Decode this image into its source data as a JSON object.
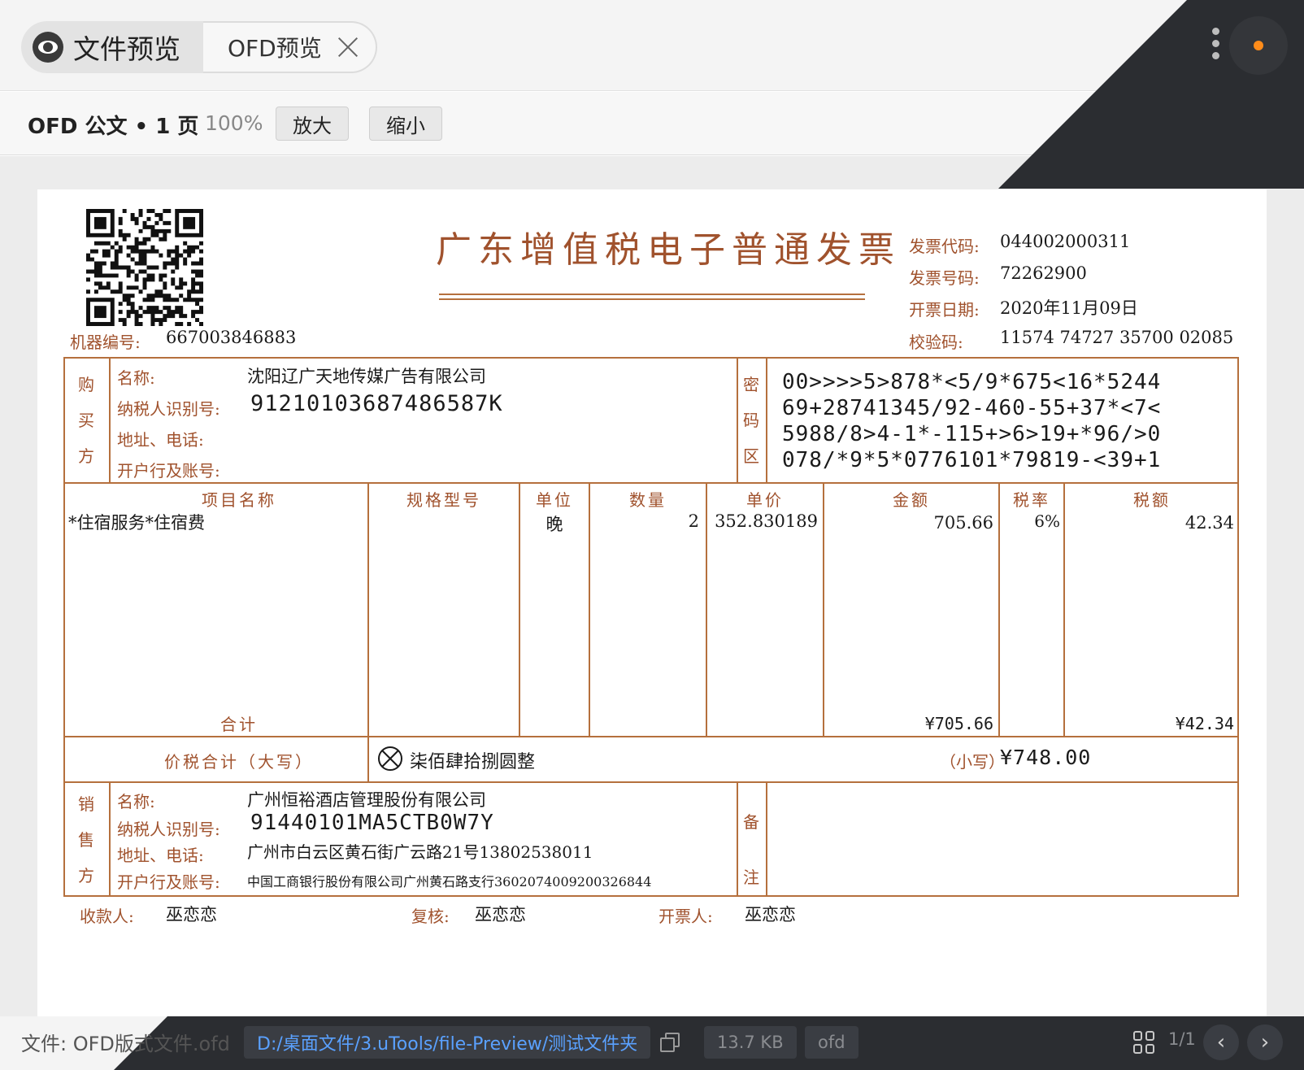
{
  "window": {
    "tabs": [
      {
        "label": "文件预览",
        "icon": "eye-icon"
      },
      {
        "label": "OFD预览",
        "icon": "close-icon"
      }
    ],
    "status_color": "#ff8c1a"
  },
  "toolbar": {
    "title": "OFD 公文 • 1 页",
    "zoom": "100%",
    "zoom_in": "放大",
    "zoom_out": "缩小"
  },
  "invoice": {
    "title": "广东增值税电子普通发票",
    "machine_label": "机器编号:",
    "machine_no": "667003846883",
    "meta": [
      {
        "label": "发票代码:",
        "value": "044002000311"
      },
      {
        "label": "发票号码:",
        "value": "72262900"
      },
      {
        "label": "开票日期:",
        "value": "2020年11月09日"
      },
      {
        "label": "校验码:",
        "value": "11574 74727 35700 02085"
      }
    ],
    "buyer": {
      "side_label": [
        "购",
        "买",
        "方"
      ],
      "name_label": "名称:",
      "name": "沈阳辽广天地传媒广告有限公司",
      "tax_label": "纳税人识别号:",
      "tax_id": "912101036874865​87K",
      "addr_label": "地址、电话:",
      "addr": "",
      "bank_label": "开户行及账号:",
      "bank": ""
    },
    "cipher": {
      "side_label": [
        "密",
        "码",
        "区"
      ],
      "lines": [
        "00>>>>5>878*<5/9*675<16*5244",
        "69+28741345/92-460-55+37*<7<",
        "5988/8>4-1*-115+>6>19+*96/>0",
        "078/*9*5*0776101*79819-<39+1"
      ]
    },
    "items_header": [
      "项目名称",
      "规格型号",
      "单位",
      "数量",
      "单价",
      "金额",
      "税率",
      "税额"
    ],
    "items": [
      {
        "name": "*住宿服务*住宿费",
        "spec": "",
        "unit": "晚",
        "qty": "2",
        "price": "352.830189",
        "amount": "705.66",
        "rate": "6%",
        "tax": "42.34"
      }
    ],
    "total_label": "合计",
    "total_amount": "¥705.66",
    "total_tax": "¥42.34",
    "grand_label": "价税合计（大写）",
    "grand_words": "柒佰肆拾捌圆整",
    "grand_small_label": "（小写）",
    "grand_small": "¥748.00",
    "seller": {
      "side_label": [
        "销",
        "售",
        "方"
      ],
      "name_label": "名称:",
      "name": "广州恒裕酒店管理股份有限公司",
      "tax_label": "纳税人识别号:",
      "tax_id": "91440101MA5CTB0W7Y",
      "addr_label": "地址、电话:",
      "addr": "广州市白云区黄石街广云路21号13802538011",
      "bank_label": "开户行及账号:",
      "bank": "中国工商银行股份有限公司广州黄石路支行3602074009200326844"
    },
    "remark_label": [
      "备",
      "注"
    ],
    "footer": [
      {
        "label": "收款人:",
        "value": "巫恋恋"
      },
      {
        "label": "复核:",
        "value": "巫恋恋"
      },
      {
        "label": "开票人:",
        "value": "巫恋恋"
      }
    ]
  },
  "statusbar": {
    "file_label": "文件:",
    "file_name": "OFD版式文件.ofd",
    "path": "D:/桌面文件/3.uTools/file-Preview/测试文件夹",
    "size": "13.7 KB",
    "type": "ofd",
    "pages": "1/1",
    "accent": "#5aa1ff"
  }
}
